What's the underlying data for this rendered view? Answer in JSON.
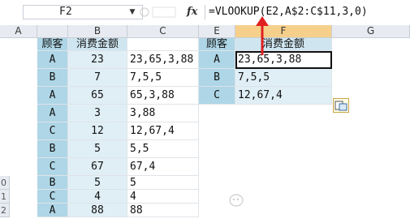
{
  "formula_bar": {
    "name_box": "F2",
    "fx_label": "fx",
    "formula": "=VLOOKUP(E2,A$2:C$11,3,0)"
  },
  "columns": [
    "A",
    "B",
    "C",
    "E",
    "F",
    "G"
  ],
  "left_table": {
    "headers": [
      "顾客",
      "消费金额",
      ""
    ],
    "rows": [
      [
        "A",
        "23",
        "23,65,3,88"
      ],
      [
        "B",
        "7",
        "7,5,5"
      ],
      [
        "A",
        "65",
        "65,3,88"
      ],
      [
        "A",
        "3",
        "3,88"
      ],
      [
        "C",
        "12",
        "12,67,4"
      ],
      [
        "B",
        "5",
        "5,5"
      ],
      [
        "C",
        "67",
        "67,4"
      ],
      [
        "B",
        "5",
        "5"
      ],
      [
        "C",
        "4",
        "4"
      ],
      [
        "A",
        "88",
        "88"
      ]
    ]
  },
  "right_table": {
    "headers": [
      "顾客",
      "消费金额"
    ],
    "rows": [
      [
        "A",
        "23,65,3,88"
      ],
      [
        "B",
        "7,5,5"
      ],
      [
        "C",
        "12,67,4"
      ]
    ]
  },
  "row_numbers": [
    "",
    "",
    "",
    "",
    "",
    "",
    "",
    "",
    "",
    "0",
    "1",
    "2"
  ],
  "selected_column": "F",
  "colors": {
    "accent": "#e02020",
    "highlight": "#aed6e6",
    "header_selected": "#f6d08b"
  },
  "icons": [
    "dropdown-arrow-icon",
    "fx-icon",
    "paste-options-icon",
    "red-arrow-icon"
  ]
}
